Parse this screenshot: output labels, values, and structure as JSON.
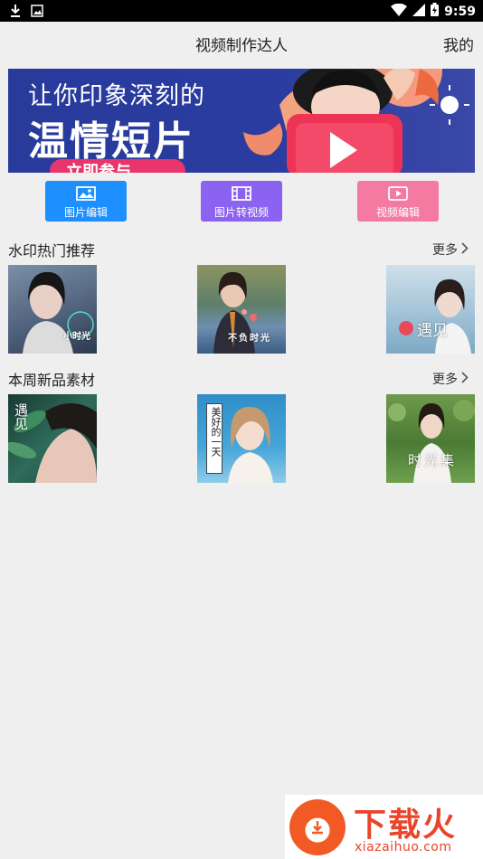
{
  "status_bar": {
    "time": "9:59",
    "left_icons": [
      "download-icon",
      "image-notification-icon"
    ],
    "right_icons": [
      "wifi-icon",
      "signal-icon",
      "battery-icon"
    ]
  },
  "header": {
    "title": "视频制作达人",
    "mine_label": "我的"
  },
  "banner": {
    "line1": "让你印象深刻的",
    "line2": "温情短片",
    "line3": "立即参与"
  },
  "actions": [
    {
      "label": "图片编辑",
      "icon": "image-icon",
      "color": "#1e8fff"
    },
    {
      "label": "图片转视频",
      "icon": "film-icon",
      "color": "#8b63f0"
    },
    {
      "label": "视频编辑",
      "icon": "video-play-icon",
      "color": "#f47aa2"
    }
  ],
  "sections": [
    {
      "title": "水印热门推荐",
      "more_label": "更多",
      "items": [
        {
          "watermark": "小时光"
        },
        {
          "watermark": "不负时光"
        },
        {
          "watermark": "遇见"
        }
      ]
    },
    {
      "title": "本周新品素材",
      "more_label": "更多",
      "items": [
        {
          "watermark": "遇见"
        },
        {
          "watermark": "美好的一天"
        },
        {
          "watermark": "时光集"
        }
      ]
    }
  ],
  "logo": {
    "brand": "下载火",
    "domain": "xiazaihuo.com"
  }
}
